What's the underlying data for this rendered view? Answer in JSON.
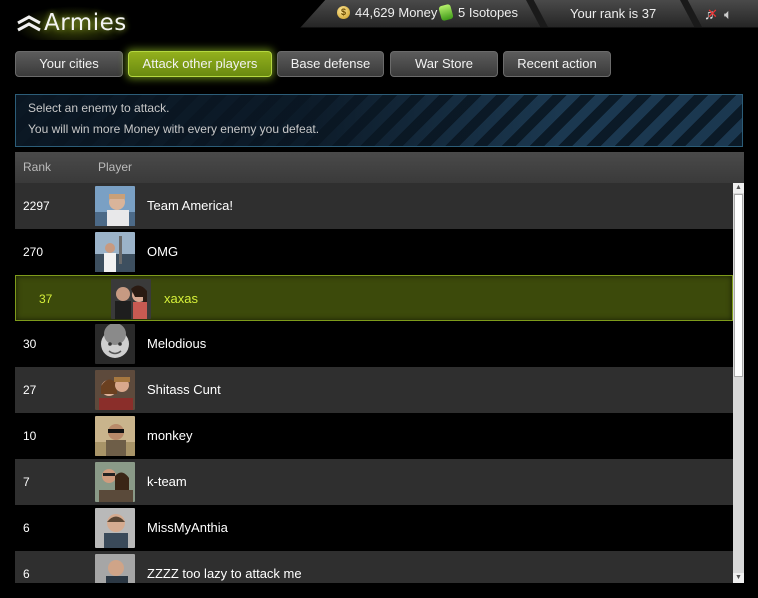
{
  "app": {
    "title": "Armies"
  },
  "status": {
    "money": "44,629 Money",
    "isotopes": "5 Isotopes",
    "rank": "Your rank is 37",
    "icons": {
      "money": "coin-icon",
      "isotopes": "isotope-icon",
      "music": "music-muted-icon",
      "sound": "speaker-icon"
    }
  },
  "tabs": [
    {
      "label": "Your cities",
      "active": false
    },
    {
      "label": "Attack other players",
      "active": true
    },
    {
      "label": "Base defense",
      "active": false
    },
    {
      "label": "War Store",
      "active": false
    },
    {
      "label": "Recent action",
      "active": false
    }
  ],
  "banner": {
    "line1": "Select an enemy to attack.",
    "line2": "You will win more Money with every enemy you defeat."
  },
  "table": {
    "headers": {
      "rank": "Rank",
      "player": "Player"
    },
    "rows": [
      {
        "rank": "2297",
        "name": "Team America!",
        "me": false
      },
      {
        "rank": "270",
        "name": "OMG",
        "me": false
      },
      {
        "rank": "37",
        "name": "xaxas",
        "me": true
      },
      {
        "rank": "30",
        "name": "Melodious",
        "me": false
      },
      {
        "rank": "27",
        "name": "Shitass Cunt",
        "me": false
      },
      {
        "rank": "10",
        "name": "monkey",
        "me": false
      },
      {
        "rank": "7",
        "name": "k-team",
        "me": false
      },
      {
        "rank": "6",
        "name": "MissMyAnthia",
        "me": false
      },
      {
        "rank": "6",
        "name": "ZZZZ too lazy to attack me",
        "me": false
      }
    ]
  },
  "colors": {
    "accent": "#93b01d",
    "highlight_text": "#d6f03a",
    "banner_border": "#2c5d78"
  }
}
